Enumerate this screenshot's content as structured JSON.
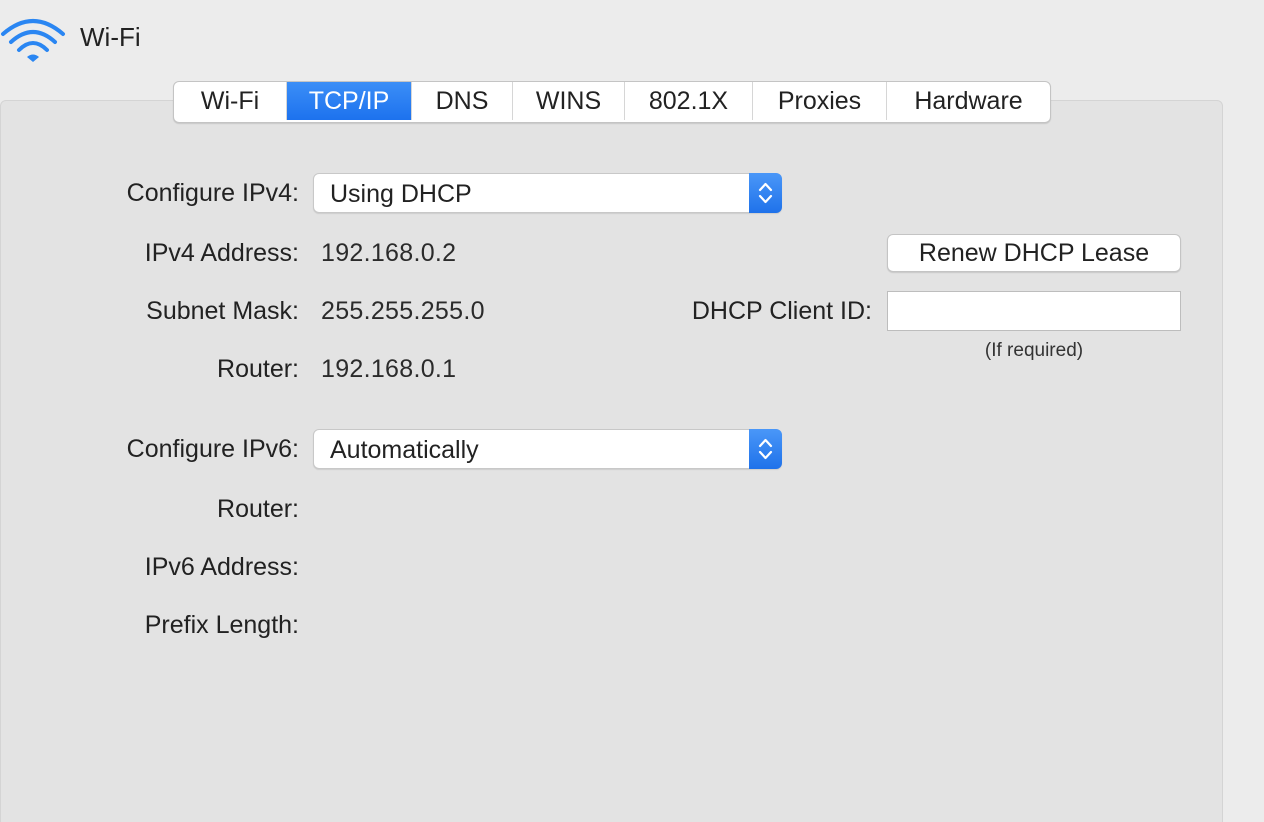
{
  "header": {
    "title": "Wi-Fi",
    "icon": "wifi-icon",
    "icon_color": "#2a86f2"
  },
  "tabs": [
    {
      "label": "Wi-Fi",
      "active": false
    },
    {
      "label": "TCP/IP",
      "active": true
    },
    {
      "label": "DNS",
      "active": false
    },
    {
      "label": "WINS",
      "active": false
    },
    {
      "label": "802.1X",
      "active": false
    },
    {
      "label": "Proxies",
      "active": false
    },
    {
      "label": "Hardware",
      "active": false
    }
  ],
  "ipv4": {
    "configure_label": "Configure IPv4:",
    "configure_value": "Using DHCP",
    "address_label": "IPv4 Address:",
    "address_value": "192.168.0.2",
    "subnet_label": "Subnet Mask:",
    "subnet_value": "255.255.255.0",
    "router_label": "Router:",
    "router_value": "192.168.0.1",
    "renew_button": "Renew DHCP Lease",
    "client_id_label": "DHCP Client ID:",
    "client_id_value": "",
    "client_id_hint": "(If required)"
  },
  "ipv6": {
    "configure_label": "Configure IPv6:",
    "configure_value": "Automatically",
    "router_label": "Router:",
    "address_label": "IPv6 Address:",
    "prefix_label": "Prefix Length:"
  },
  "colors": {
    "accent": "#2a80f5",
    "background": "#ececec",
    "panel": "#e3e3e3"
  }
}
